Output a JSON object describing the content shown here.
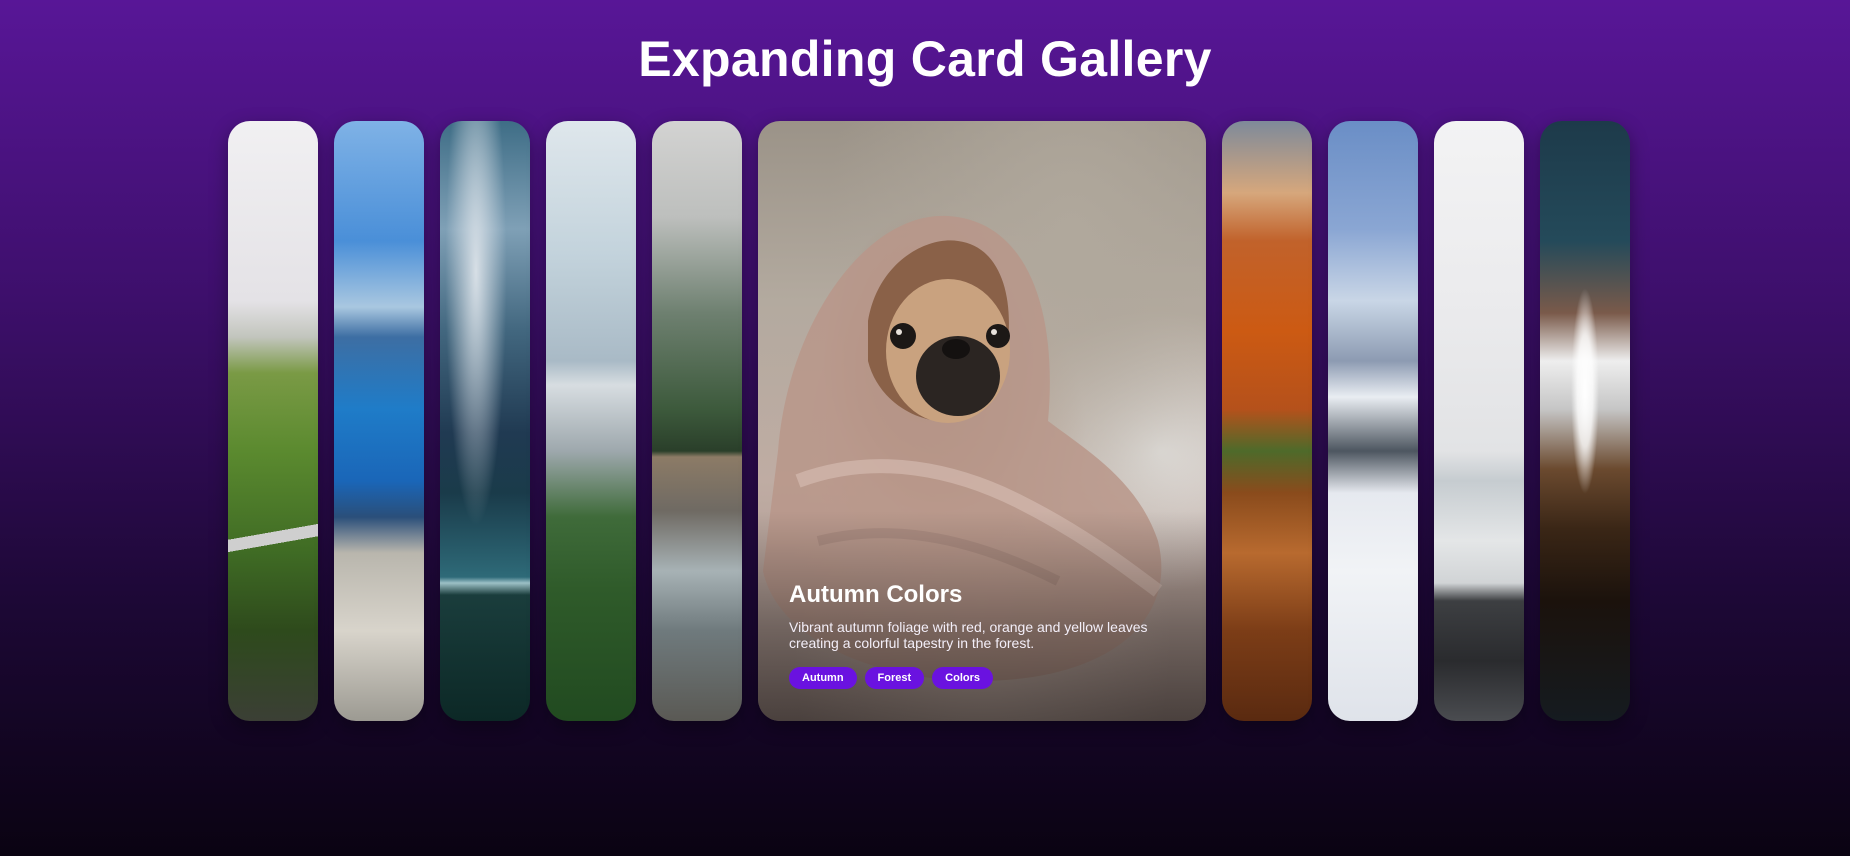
{
  "page": {
    "title": "Expanding Card Gallery"
  },
  "gallery": {
    "cards": [
      {
        "id": "card-1",
        "image": "green-hills-road"
      },
      {
        "id": "card-2",
        "image": "fjord-cliff"
      },
      {
        "id": "card-3",
        "image": "stormy-sea"
      },
      {
        "id": "card-4",
        "image": "castle-forest"
      },
      {
        "id": "card-5",
        "image": "river-hiker"
      },
      {
        "id": "card-6",
        "image": "pug-in-blanket",
        "active": true,
        "title": "Autumn Colors",
        "description": "Vibrant autumn foliage with red, orange and yellow leaves creating a colorful tapestry in the forest.",
        "tags": [
          "Autumn",
          "Forest",
          "Colors"
        ]
      },
      {
        "id": "card-7",
        "image": "orange-canyon"
      },
      {
        "id": "card-8",
        "image": "snowy-mountain"
      },
      {
        "id": "card-9",
        "image": "misty-beach"
      },
      {
        "id": "card-10",
        "image": "coffee-pour-over"
      }
    ]
  },
  "colors": {
    "background_top": "#581697",
    "background_bottom": "#0a0312",
    "tag_background": "#6a12e0"
  }
}
